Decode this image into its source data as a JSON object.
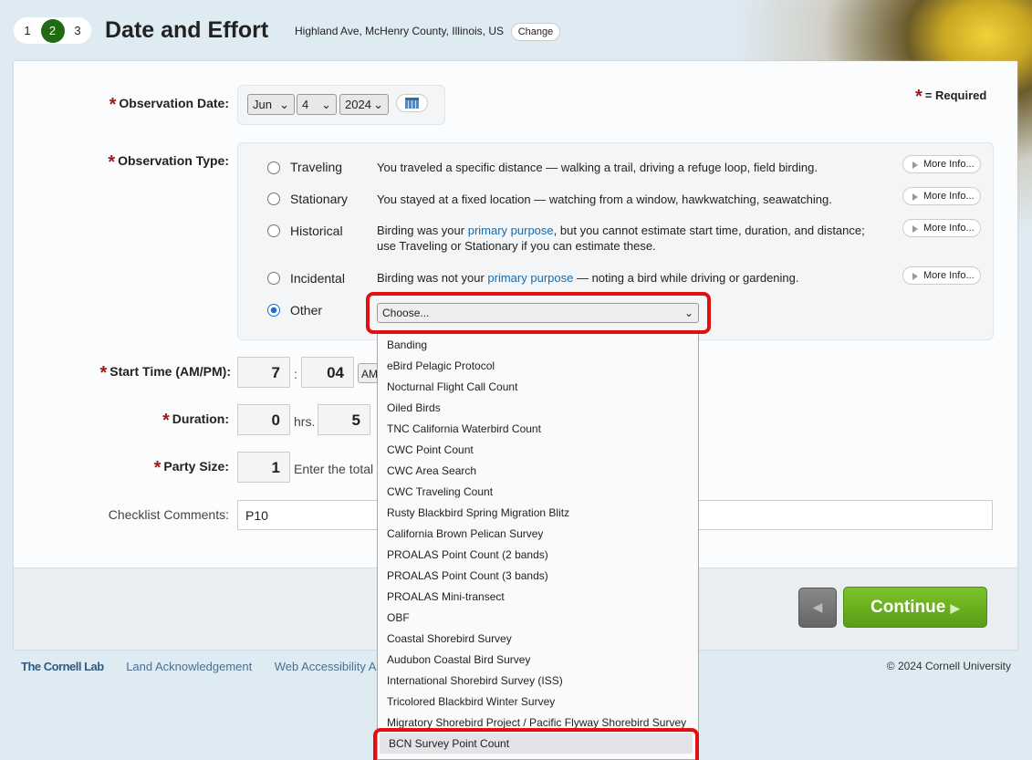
{
  "steps": [
    "1",
    "2",
    "3"
  ],
  "header": {
    "title": "Date and Effort",
    "location": "Highland Ave, McHenry County, Illinois, US",
    "change": "Change"
  },
  "required_note": "= Required",
  "date": {
    "label": "Observation Date:",
    "month": "Jun",
    "day": "4",
    "year": "2024"
  },
  "obs_type": {
    "label": "Observation Type:",
    "more_info": "More Info...",
    "options": [
      {
        "name": "Traveling",
        "desc": "You traveled a specific distance — walking a trail, driving a refuge loop, field birding."
      },
      {
        "name": "Stationary",
        "desc": "You stayed at a fixed location — watching from a window, hawkwatching, seawatching."
      },
      {
        "name": "Historical",
        "desc_a": "Birding was your ",
        "link": "primary purpose",
        "desc_b": ", but you cannot estimate start time, duration, and distance; use Traveling or Stationary if you can estimate these."
      },
      {
        "name": "Incidental",
        "desc_a": "Birding was not your ",
        "link": "primary purpose",
        "desc_b": " — noting a bird while driving or gardening."
      },
      {
        "name": "Other",
        "selected": true
      }
    ],
    "other_select": "Choose..."
  },
  "start_time": {
    "label": "Start Time (AM/PM):",
    "hour": "7",
    "minute": "04",
    "ampm": "AM"
  },
  "duration": {
    "label": "Duration:",
    "hours": "0",
    "hrs": "hrs.",
    "minutes": "5"
  },
  "party": {
    "label": "Party Size:",
    "value": "1",
    "hint": "Enter the total n"
  },
  "comments": {
    "label": "Checklist Comments:",
    "value": "P10"
  },
  "dropdown": [
    "Banding",
    "eBird Pelagic Protocol",
    "Nocturnal Flight Call Count",
    "Oiled Birds",
    "TNC California Waterbird Count",
    "CWC Point Count",
    "CWC Area Search",
    "CWC Traveling Count",
    "Rusty Blackbird Spring Migration Blitz",
    "California Brown Pelican Survey",
    "PROALAS Point Count (2 bands)",
    "PROALAS Point Count (3 bands)",
    "PROALAS Mini-transect",
    "OBF",
    "Coastal Shorebird Survey",
    "Audubon Coastal Bird Survey",
    "International Shorebird Survey (ISS)",
    "Tricolored Blackbird Winter Survey",
    "Migratory Shorebird Project / Pacific Flyway Shorebird Survey",
    "BCN Survey Point Count"
  ],
  "buttons": {
    "continue": "Continue"
  },
  "footer": {
    "brand": "The Cornell Lab",
    "links": [
      "Land Acknowledgement",
      "Web Accessibility Ass"
    ],
    "copyright": "© 2024 Cornell University"
  }
}
